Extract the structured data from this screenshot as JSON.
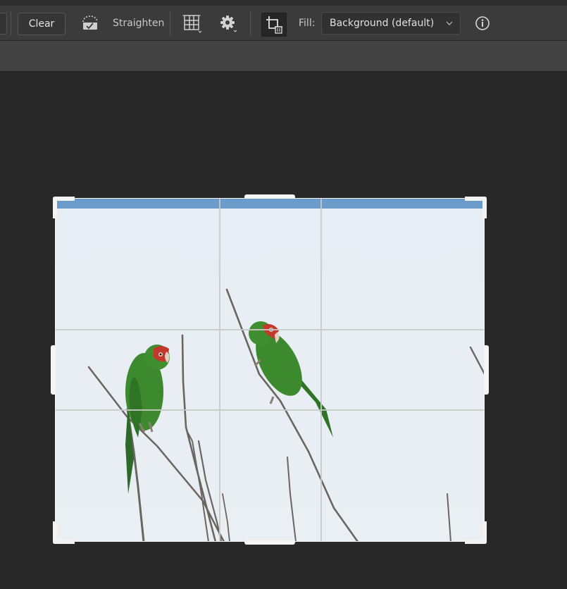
{
  "options_bar": {
    "clear_label": "Clear",
    "straighten_label": "Straighten",
    "fill_label": "Fill:",
    "fill_value": "Background (default)",
    "icons": {
      "straighten": "straighten-level-icon",
      "grid_overlay": "grid-overlay-icon",
      "settings": "gear-icon",
      "delete_cropped": "crop-delete-pixels-icon",
      "info": "info-icon",
      "fill_dropdown": "chevron-down-icon"
    }
  },
  "canvas": {
    "background_color": "#282828",
    "image_subject": "two green parrots on bare branches",
    "overlay": "rule-of-thirds"
  },
  "colors": {
    "toolbar_bg": "#3b3b3b",
    "tab_strip_bg": "#424242",
    "canvas_bg": "#282828",
    "crop_handle": "#f4f4f4",
    "sky": "#e7eef4",
    "top_band": "#6b9bc8",
    "parrot_green": "#3d8a2e",
    "parrot_red": "#c0392b"
  }
}
